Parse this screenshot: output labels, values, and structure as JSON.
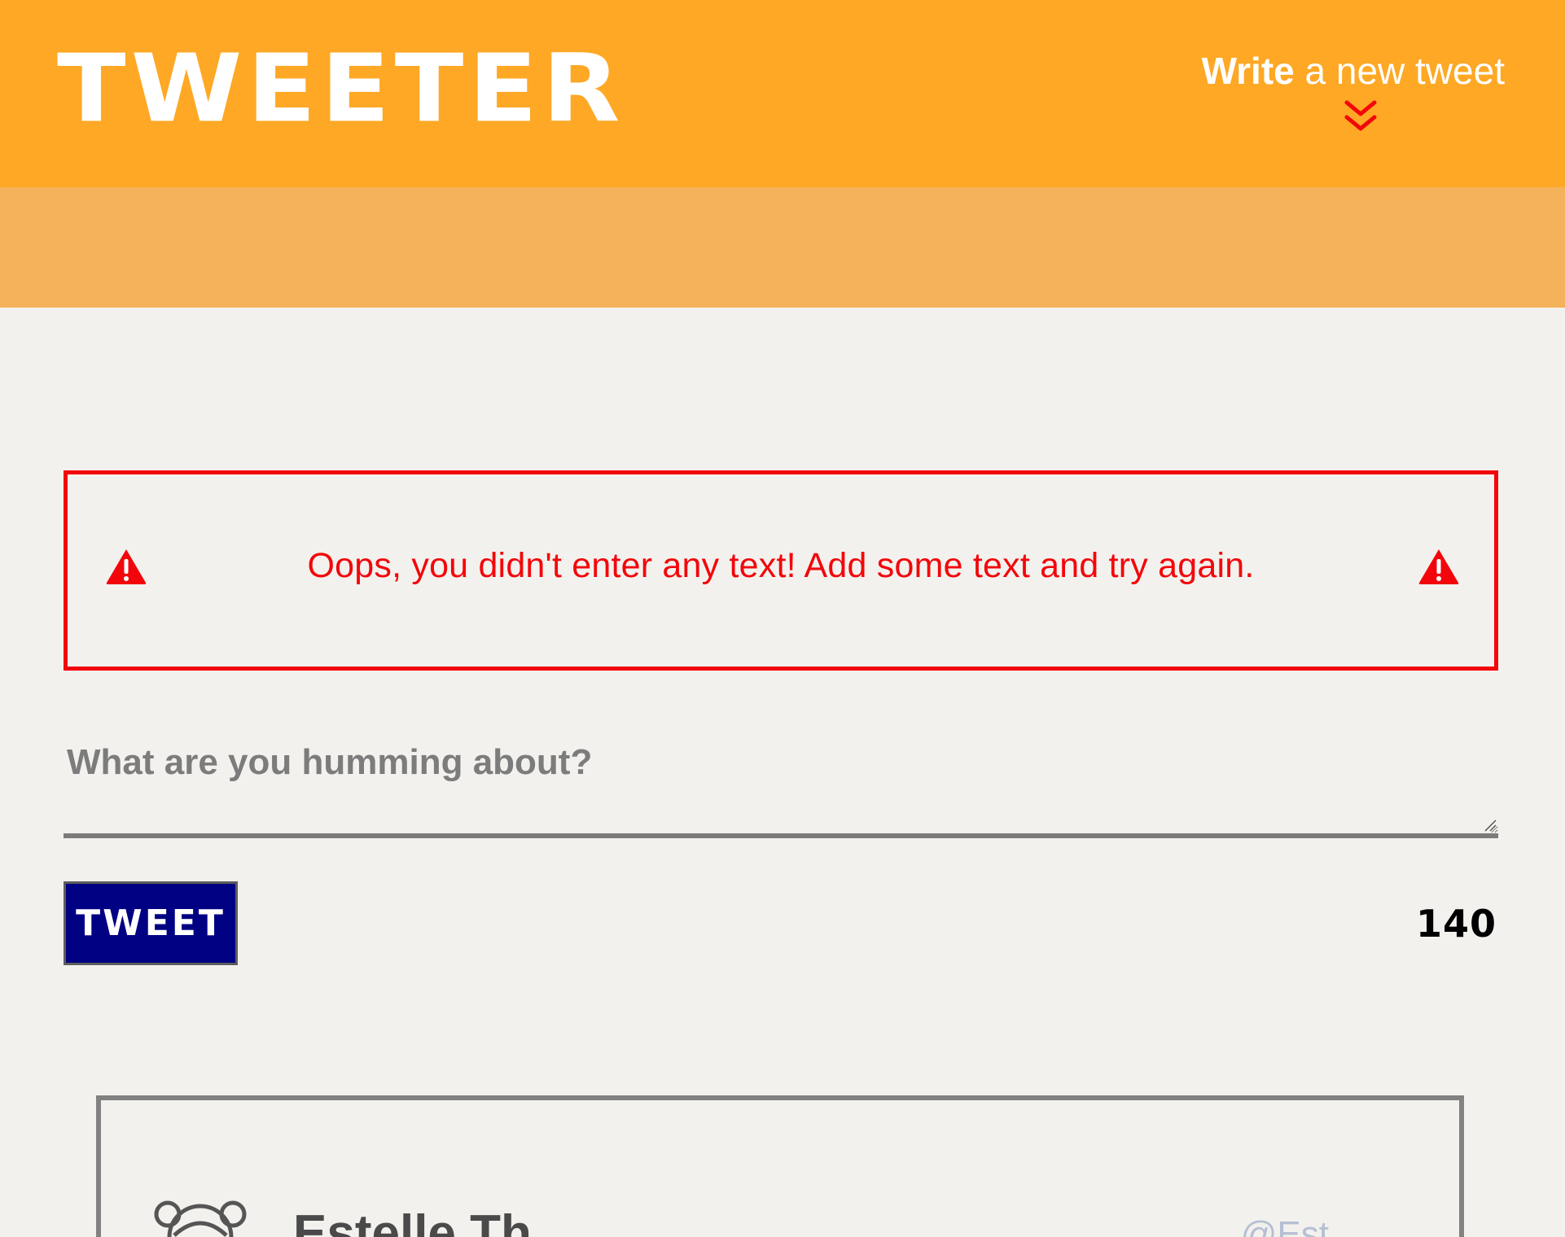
{
  "header": {
    "logo": "TWEETER",
    "write_link": {
      "bold": "Write",
      "rest": " a new tweet"
    },
    "chevron_icon": "double-chevron-down-icon",
    "background_color": "#fea825",
    "band_color": "#f4b25a"
  },
  "error": {
    "message": "Oops, you didn't enter any text! Add some text and try again.",
    "icon": "warning-triangle-icon",
    "color": "#f3060b"
  },
  "composer": {
    "placeholder": "What are you humming about?",
    "value": ""
  },
  "tweet_button": {
    "label": "TWEET",
    "color": "#000082"
  },
  "counter": {
    "value": "140"
  },
  "tweet_card": {
    "author_name": "Estelle Th",
    "author_handle": "@Est",
    "avatar_icon": "avatar-icon"
  }
}
